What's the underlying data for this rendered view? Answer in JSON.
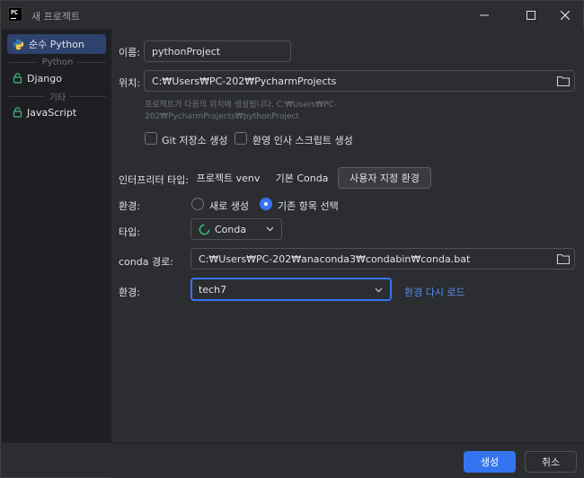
{
  "window": {
    "title": "새 프로젝트",
    "app_icon_text": "PC"
  },
  "sidebar": {
    "items": [
      {
        "label": "순수 Python",
        "icon": "python-icon",
        "selected": true
      },
      {
        "label": "Django",
        "icon": "lock-icon"
      },
      {
        "label": "JavaScript",
        "icon": "lock-icon"
      }
    ],
    "groups": [
      "Python",
      "기타"
    ]
  },
  "form": {
    "name_label": "이름:",
    "name_value": "pythonProject",
    "location_label": "위치:",
    "location_value": "C:₩Users₩PC-202₩PycharmProjects",
    "hint_line1": "프로젝트가 다음의 위치에 생성됩니다. C:₩Users₩PC-",
    "hint_line2": "202₩PycharmProjects₩pythonProject",
    "git_label": "Git 저장소 생성",
    "welcome_label": "환영 인사 스크립트 생성",
    "interpreter_label": "인터프리터 타입:",
    "interpreter_options": [
      "프로젝트 venv",
      "기본 Conda",
      "사용자 지정 환경"
    ],
    "interpreter_selected": "사용자 지정 환경",
    "env_label": "환경:",
    "env_new": "새로 생성",
    "env_existing": "기존 항목 선택",
    "type_label": "타입:",
    "type_value": "Conda",
    "conda_path_label": "conda 경로:",
    "conda_path_value": "C:₩Users₩PC-202₩anaconda3₩condabin₩conda.bat",
    "env2_label": "환경:",
    "env2_value": "tech7",
    "reload_link": "환경 다시 로드"
  },
  "footer": {
    "create_label": "생성",
    "cancel_label": "취소"
  },
  "colors": {
    "accent": "#3574f0",
    "link": "#548af7",
    "sidebar_selected": "#2e436e"
  }
}
